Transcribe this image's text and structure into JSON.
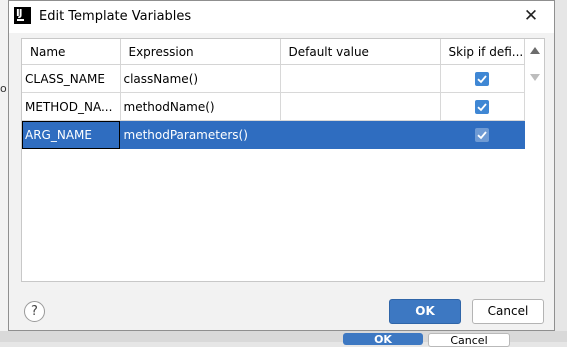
{
  "background": {
    "left_char": "o",
    "ok_label": "OK",
    "cancel_label": "Cancel"
  },
  "dialog": {
    "title": "Edit Template Variables",
    "close_glyph": "✕",
    "app_icon_letters": "IJ"
  },
  "table": {
    "columns": [
      "Name",
      "Expression",
      "Default value",
      "Skip if defi..."
    ],
    "rows": [
      {
        "name": "CLASS_NAME",
        "expression": "className()",
        "default_value": "",
        "skip_if_defined": true
      },
      {
        "name": "METHOD_NA...",
        "expression": "methodName()",
        "default_value": "",
        "skip_if_defined": true
      },
      {
        "name": "ARG_NAME",
        "expression": "methodParameters()",
        "default_value": "",
        "skip_if_defined": true
      }
    ],
    "selected_row": 2
  },
  "footer": {
    "help_label": "?",
    "ok_label": "OK",
    "cancel_label": "Cancel"
  },
  "colors": {
    "accent": "#3d78c2",
    "selection": "#2f6dc0",
    "checkbox": "#3f87d4"
  }
}
